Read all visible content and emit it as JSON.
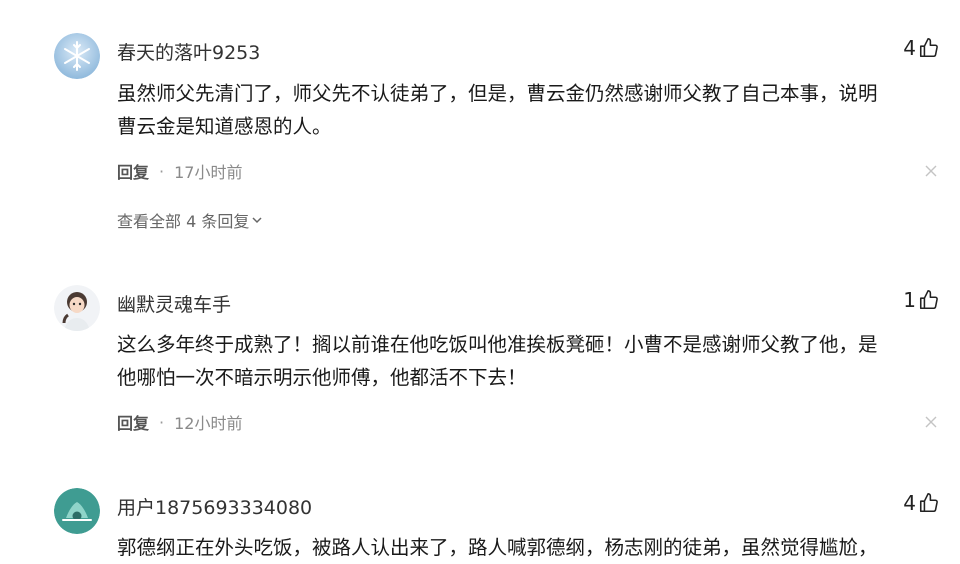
{
  "comments": [
    {
      "username": "春天的落叶9253",
      "likes": "4",
      "text_lines": [
        "虽然师父先清门了，师父先不认徒弟了，但是，曹云金仍然感谢师父教了自己本事，说明",
        "曹云金是知道感恩的人。"
      ],
      "reply_label": "回复",
      "separator": "·",
      "time": "17小时前",
      "view_all": "查看全部 4 条回复"
    },
    {
      "username": "幽默灵魂车手",
      "likes": "1",
      "text_lines": [
        "这么多年终于成熟了！搁以前谁在他吃饭叫他准挨板凳砸！小曹不是感谢师父教了他，是",
        "他哪怕一次不暗示明示他师傅，他都活不下去！"
      ],
      "reply_label": "回复",
      "separator": "·",
      "time": "12小时前"
    },
    {
      "username": "用户1875693334080",
      "likes": "4",
      "text_lines": [
        "郭德纲正在外头吃饭，被路人认出来了，路人喊郭德纲，杨志刚的徒弟，虽然觉得尴尬，"
      ]
    }
  ],
  "icons": {
    "like": "thumbs-up-outline-icon",
    "close": "close-x-icon",
    "expand": "chevron-down-icon"
  },
  "colors": {
    "avatar1": "#7fb0d8",
    "avatar3": "#4aa39a"
  }
}
